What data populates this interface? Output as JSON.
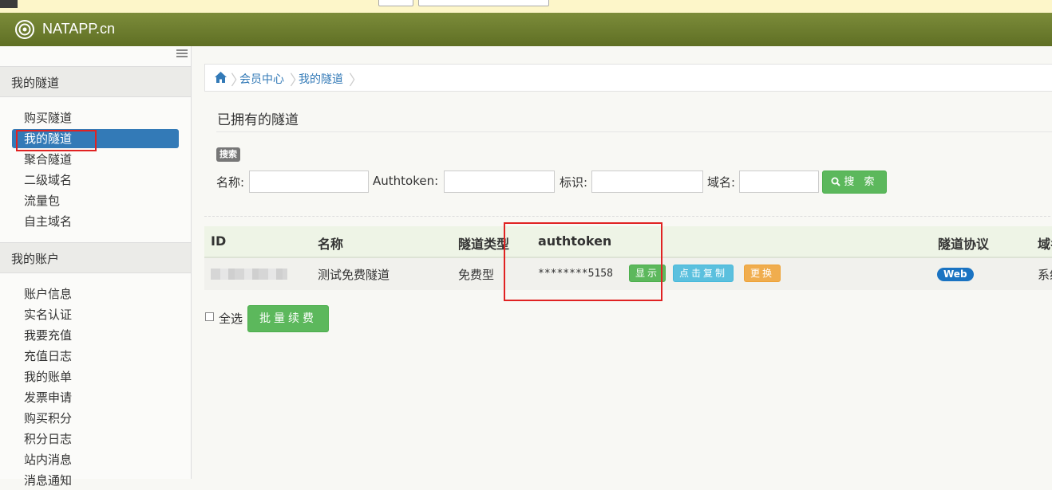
{
  "brand": {
    "name": "NATAPP.cn"
  },
  "sidebar": {
    "sections": [
      {
        "title": "我的隧道",
        "items": [
          "购买隧道",
          "我的隧道",
          "聚合隧道",
          "二级域名",
          "流量包",
          "自主域名"
        ]
      },
      {
        "title": "我的账户",
        "items": [
          "账户信息",
          "实名认证",
          "我要充值",
          "充值日志",
          "我的账单",
          "发票申请",
          "购买积分",
          "积分日志",
          "站内消息",
          "消息通知"
        ]
      }
    ],
    "active_item": "我的隧道"
  },
  "breadcrumb": {
    "items": [
      "会员中心",
      "我的隧道"
    ]
  },
  "page": {
    "title": "已拥有的隧道"
  },
  "search": {
    "badge": "搜索",
    "fields": [
      {
        "label": "名称:",
        "value": ""
      },
      {
        "label": "Authtoken:",
        "value": ""
      },
      {
        "label": "标识:",
        "value": ""
      },
      {
        "label": "域名:",
        "value": ""
      }
    ],
    "button": "搜 索"
  },
  "table": {
    "headers": [
      "ID",
      "名称",
      "隧道类型",
      "authtoken",
      "隧道协议",
      "域名"
    ],
    "rows": [
      {
        "name": "测试免费隧道",
        "type": "免费型",
        "authtoken": "********5158",
        "actions": [
          "显示",
          "点击复制",
          "更换"
        ],
        "protocol": "Web",
        "domain": "系统"
      }
    ]
  },
  "footer": {
    "select_all": "全选",
    "renew_button": "批量续费"
  },
  "colors": {
    "header": "#6a7a2c",
    "active": "#337ab7",
    "success": "#5cb85c",
    "info": "#5bc0de",
    "warning": "#f0ad4e",
    "highlight": "#e02222"
  }
}
